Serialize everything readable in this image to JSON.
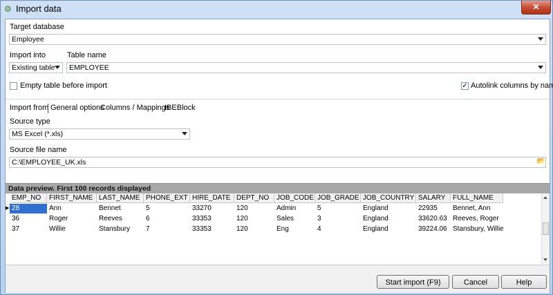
{
  "window": {
    "title": "Import data",
    "close_glyph": "✕",
    "app_icon": "gears-icon"
  },
  "target_database": {
    "label": "Target database",
    "value": "Employee"
  },
  "import_into": {
    "label": "Import into",
    "value": "Existing table"
  },
  "table_name": {
    "label": "Table name",
    "value": "EMPLOYEE"
  },
  "empty_table": {
    "label": "Empty table before import",
    "checked": false
  },
  "autolink": {
    "label": "Autolink columns by name",
    "checked": true,
    "check_glyph": "✓"
  },
  "tabs": [
    "Import from",
    "General options",
    "Columns / Mappings",
    "IBEBlock"
  ],
  "source_type": {
    "label": "Source type",
    "value": "MS Excel (*.xls)"
  },
  "source_file": {
    "label": "Source file name",
    "value": "C:\\EMPLOYEE_UK.xls",
    "browse_icon": "folder-open-icon",
    "browse_glyph": "📂"
  },
  "preview": {
    "header": "Data preview. First 100 records displayed",
    "columns": [
      "EMP_NO",
      "FIRST_NAME",
      "LAST_NAME",
      "PHONE_EXT",
      "HIRE_DATE",
      "DEPT_NO",
      "JOB_CODE",
      "JOB_GRADE",
      "JOB_COUNTRY",
      "SALARY",
      "FULL_NAME"
    ],
    "rows": [
      [
        "28",
        "Ann",
        "Bennet",
        "5",
        "33270",
        "120",
        "Admin",
        "5",
        "England",
        "22935",
        "Bennet, Ann"
      ],
      [
        "36",
        "Roger",
        "Reeves",
        "6",
        "33353",
        "120",
        "Sales",
        "3",
        "England",
        "33620.63",
        "Reeves, Roger"
      ],
      [
        "37",
        "Willie",
        "Stansbury",
        "7",
        "33353",
        "120",
        "Eng",
        "4",
        "England",
        "39224.06",
        "Stansbury, Willie"
      ]
    ],
    "row_indicator": "▶"
  },
  "buttons": {
    "start_import": "Start import (F9)",
    "cancel": "Cancel",
    "help": "Help"
  }
}
